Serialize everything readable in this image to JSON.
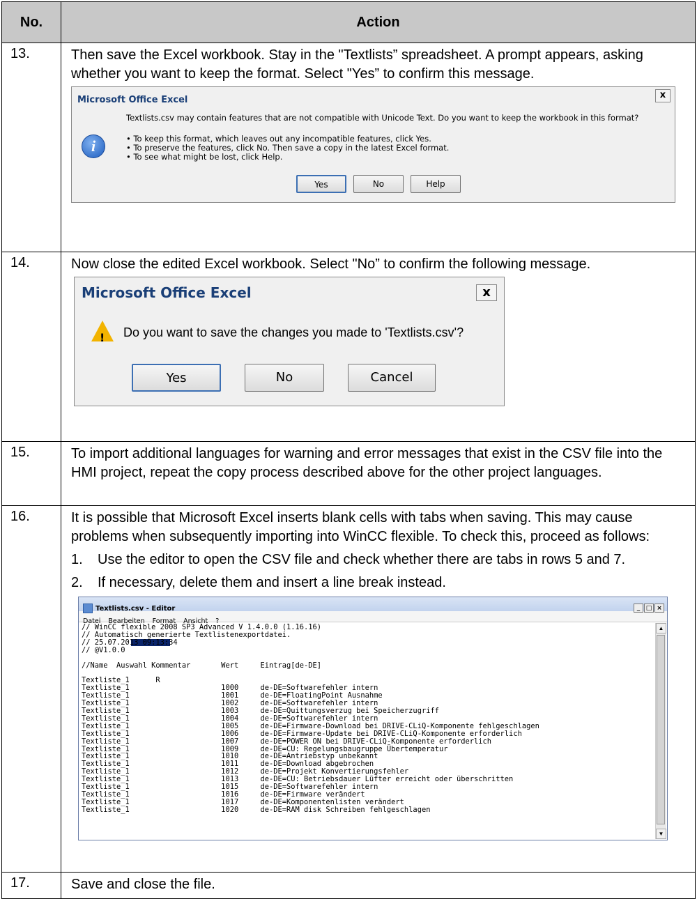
{
  "table": {
    "header_no": "No.",
    "header_action": "Action"
  },
  "rows": [
    {
      "no": "13.",
      "text": "Then save the Excel workbook. Stay in the \"Textlists” spreadsheet. A prompt appears, asking whether you want to keep the format. Select \"Yes” to confirm this message.",
      "dialog": {
        "title": "Microsoft Office Excel",
        "close": "x",
        "icon": "info-icon",
        "message": "Textlists.csv may contain features that are not compatible with Unicode Text.  Do you want to keep the workbook in this format?",
        "bullets": [
          "• To keep this format, which leaves out any incompatible features, click Yes.",
          "• To preserve the features, click No. Then save a copy in the latest Excel format.",
          "• To see what might be lost, click Help."
        ],
        "buttons": [
          "Yes",
          "No",
          "Help"
        ]
      }
    },
    {
      "no": "14.",
      "text": "Now close the edited Excel workbook. Select \"No” to confirm the following message.",
      "dialog": {
        "title": "Microsoft Office Excel",
        "close": "x",
        "icon": "warning-icon",
        "message": "Do you want to save the changes you made to 'Textlists.csv'?",
        "buttons": [
          "Yes",
          "No",
          "Cancel"
        ]
      }
    },
    {
      "no": "15.",
      "text": "To import additional languages for warning and error messages that exist in the CSV file into the HMI project, repeat the copy process described above for the other project languages."
    },
    {
      "no": "16.",
      "text": "It is possible that Microsoft Excel inserts blank cells with tabs when saving. This may cause problems when subsequently importing into WinCC flexible. To check this, proceed as follows:",
      "steps": [
        {
          "n": "1.",
          "text": "Use the editor to open the CSV file and check whether there are tabs in rows 5 and 7."
        },
        {
          "n": "2.",
          "text": "If necessary, delete them and insert a line break instead."
        }
      ],
      "editor": {
        "title": "Textlists.csv - Editor",
        "menu": [
          "Datei",
          "Bearbeiten",
          "Format",
          "Ansicht",
          "?"
        ],
        "lines": [
          "// WinCC flexible 2008 SP3 Advanced V 1.4.0.0 (1.16.16)",
          "// Automatisch generierte Textlistenexportdatei.",
          "// 25.07.2013 09:13:34",
          "// @V1.0.0",
          "",
          "//Name  Auswahl Kommentar       Wert     Eintrag[de-DE]",
          "",
          "Textliste_1      R",
          "Textliste_1                     1000     de-DE=Softwarefehler intern",
          "Textliste_1                     1001     de-DE=FloatingPoint Ausnahme",
          "Textliste_1                     1002     de-DE=Softwarefehler intern",
          "Textliste_1                     1003     de-DE=Quittungsverzug bei Speicherzugriff",
          "Textliste_1                     1004     de-DE=Softwarefehler intern",
          "Textliste_1                     1005     de-DE=Firmware-Download bei DRIVE-CLiQ-Komponente fehlgeschlagen",
          "Textliste_1                     1006     de-DE=Firmware-Update bei DRIVE-CLiQ-Komponente erforderlich",
          "Textliste_1                     1007     de-DE=POWER ON bei DRIVE-CLiQ-Komponente erforderlich",
          "Textliste_1                     1009     de-DE=CU: Regelungsbaugruppe Übertemperatur",
          "Textliste_1                     1010     de-DE=Antriebstyp unbekannt",
          "Textliste_1                     1011     de-DE=Download abgebrochen",
          "Textliste_1                     1012     de-DE=Projekt Konvertierungsfehler",
          "Textliste_1                     1013     de-DE=CU: Betriebsdauer Lüfter erreicht oder überschritten",
          "Textliste_1                     1015     de-DE=Softwarefehler intern",
          "Textliste_1                     1016     de-DE=Firmware verändert",
          "Textliste_1                     1017     de-DE=Komponentenlisten verändert",
          "Textliste_1                     1020     de-DE=RAM disk Schreiben fehlgeschlagen"
        ]
      }
    },
    {
      "no": "17.",
      "text": "Save and close the file."
    }
  ]
}
